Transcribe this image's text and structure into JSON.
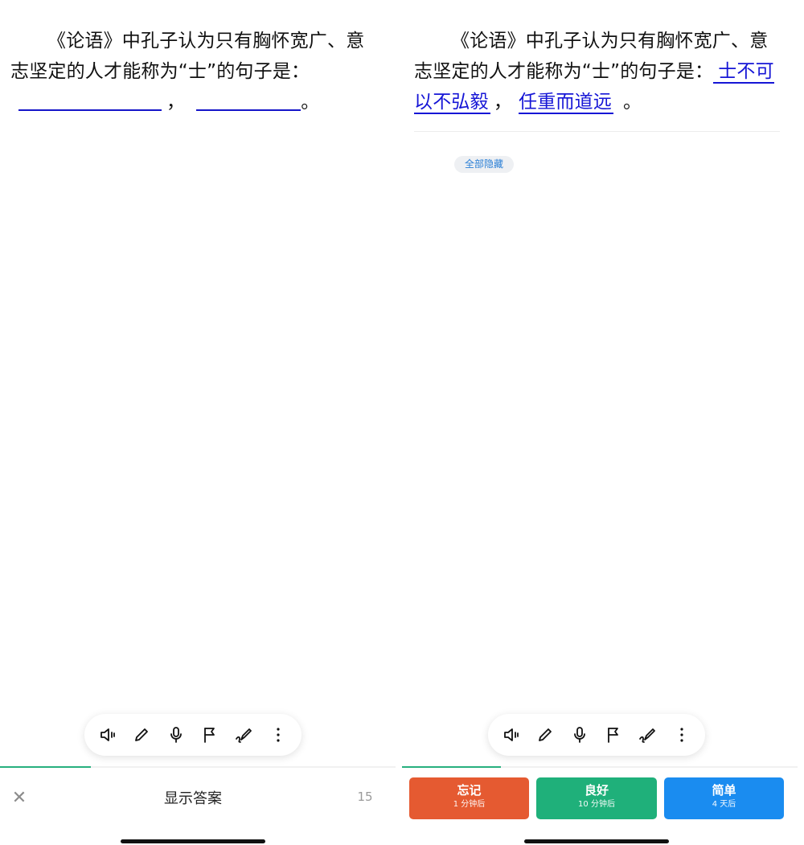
{
  "question": {
    "line_text": "《论语》中孔子认为只有胸怀宽广、意志坚定的人才能称为“士”的句子是：",
    "separator": "，",
    "end_mark": "。"
  },
  "answers": [
    "士不可以不弘毅",
    "任重而道远"
  ],
  "hide_all_label": "全部隐藏",
  "toolbar": {
    "icons": [
      "speaker-icon",
      "pencil-icon",
      "microphone-icon",
      "flag-icon",
      "brush-icon",
      "more-icon"
    ]
  },
  "bottom": {
    "close_glyph": "✕",
    "show_answer_label": "显示答案",
    "counter": "15"
  },
  "ratings": {
    "forgot": {
      "label": "忘记",
      "interval": "1 分钟后"
    },
    "good": {
      "label": "良好",
      "interval": "10 分钟后"
    },
    "easy": {
      "label": "简单",
      "interval": "4 天后"
    }
  },
  "colors": {
    "answer_blue": "#1616d6",
    "progress_green": "#27b07e",
    "forgot_red": "#e55a31",
    "good_green": "#1fb07a",
    "easy_blue": "#1a8cf0"
  },
  "progress": {
    "left_fraction": 0.23,
    "right_fraction": 0.25
  }
}
